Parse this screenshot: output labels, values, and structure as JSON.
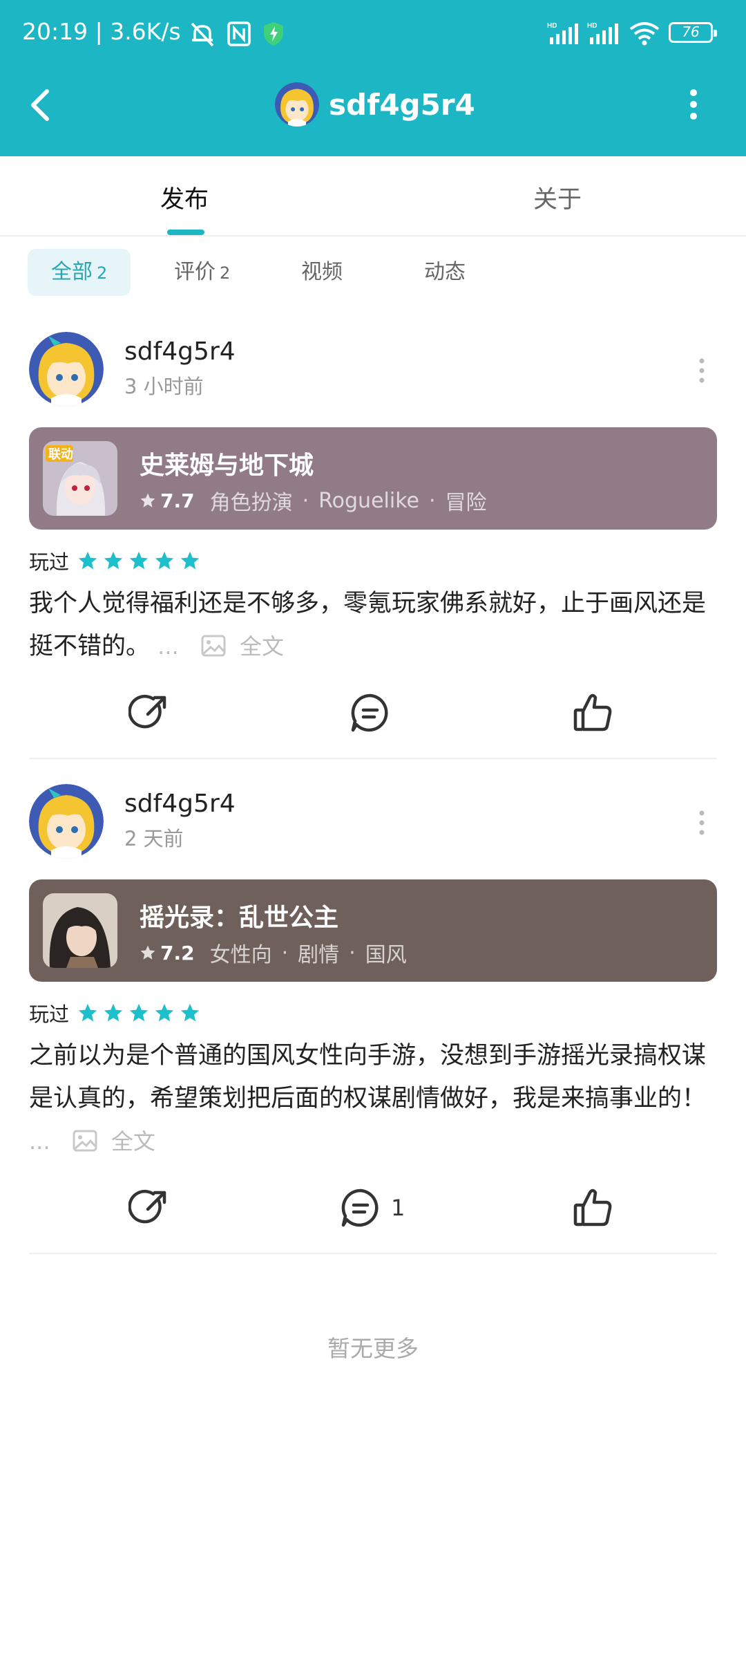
{
  "status_bar": {
    "time": "20:19 | 3.6K/s",
    "battery": "76"
  },
  "nav": {
    "title": "sdf4g5r4"
  },
  "tabs": [
    {
      "label": "发布"
    },
    {
      "label": "关于"
    }
  ],
  "filters": [
    {
      "label": "全部",
      "count": "2"
    },
    {
      "label": "评价",
      "count": "2"
    },
    {
      "label": "视频",
      "count": ""
    },
    {
      "label": "动态",
      "count": ""
    }
  ],
  "posts": [
    {
      "author": "sdf4g5r4",
      "time": "3 小时前",
      "game": {
        "name": "史莱姆与地下城",
        "score": "7.7",
        "tags": [
          "角色扮演",
          "Roguelike",
          "冒险"
        ],
        "card_color": "#907b86"
      },
      "played_label": "玩过",
      "stars": 5,
      "review": "我个人觉得福利还是不够多，零氪玩家佛系就好，止于画风还是挺不错的。",
      "ellipsis": "...",
      "full_text_label": "全文",
      "comment_count": ""
    },
    {
      "author": "sdf4g5r4",
      "time": "2 天前",
      "game": {
        "name": "摇光录：乱世公主",
        "score": "7.2",
        "tags": [
          "女性向",
          "剧情",
          "国风"
        ],
        "card_color": "#6f605b"
      },
      "played_label": "玩过",
      "stars": 5,
      "review": "之前以为是个普通的国风女性向手游，没想到手游摇光录搞权谋是认真的，希望策划把后面的权谋剧情做好，我是来搞事业的！",
      "ellipsis": "...",
      "full_text_label": "全文",
      "comment_count": "1"
    }
  ],
  "footer": {
    "no_more": "暂无更多"
  },
  "colors": {
    "accent": "#1cb6c4",
    "star": "#1cbfca"
  }
}
